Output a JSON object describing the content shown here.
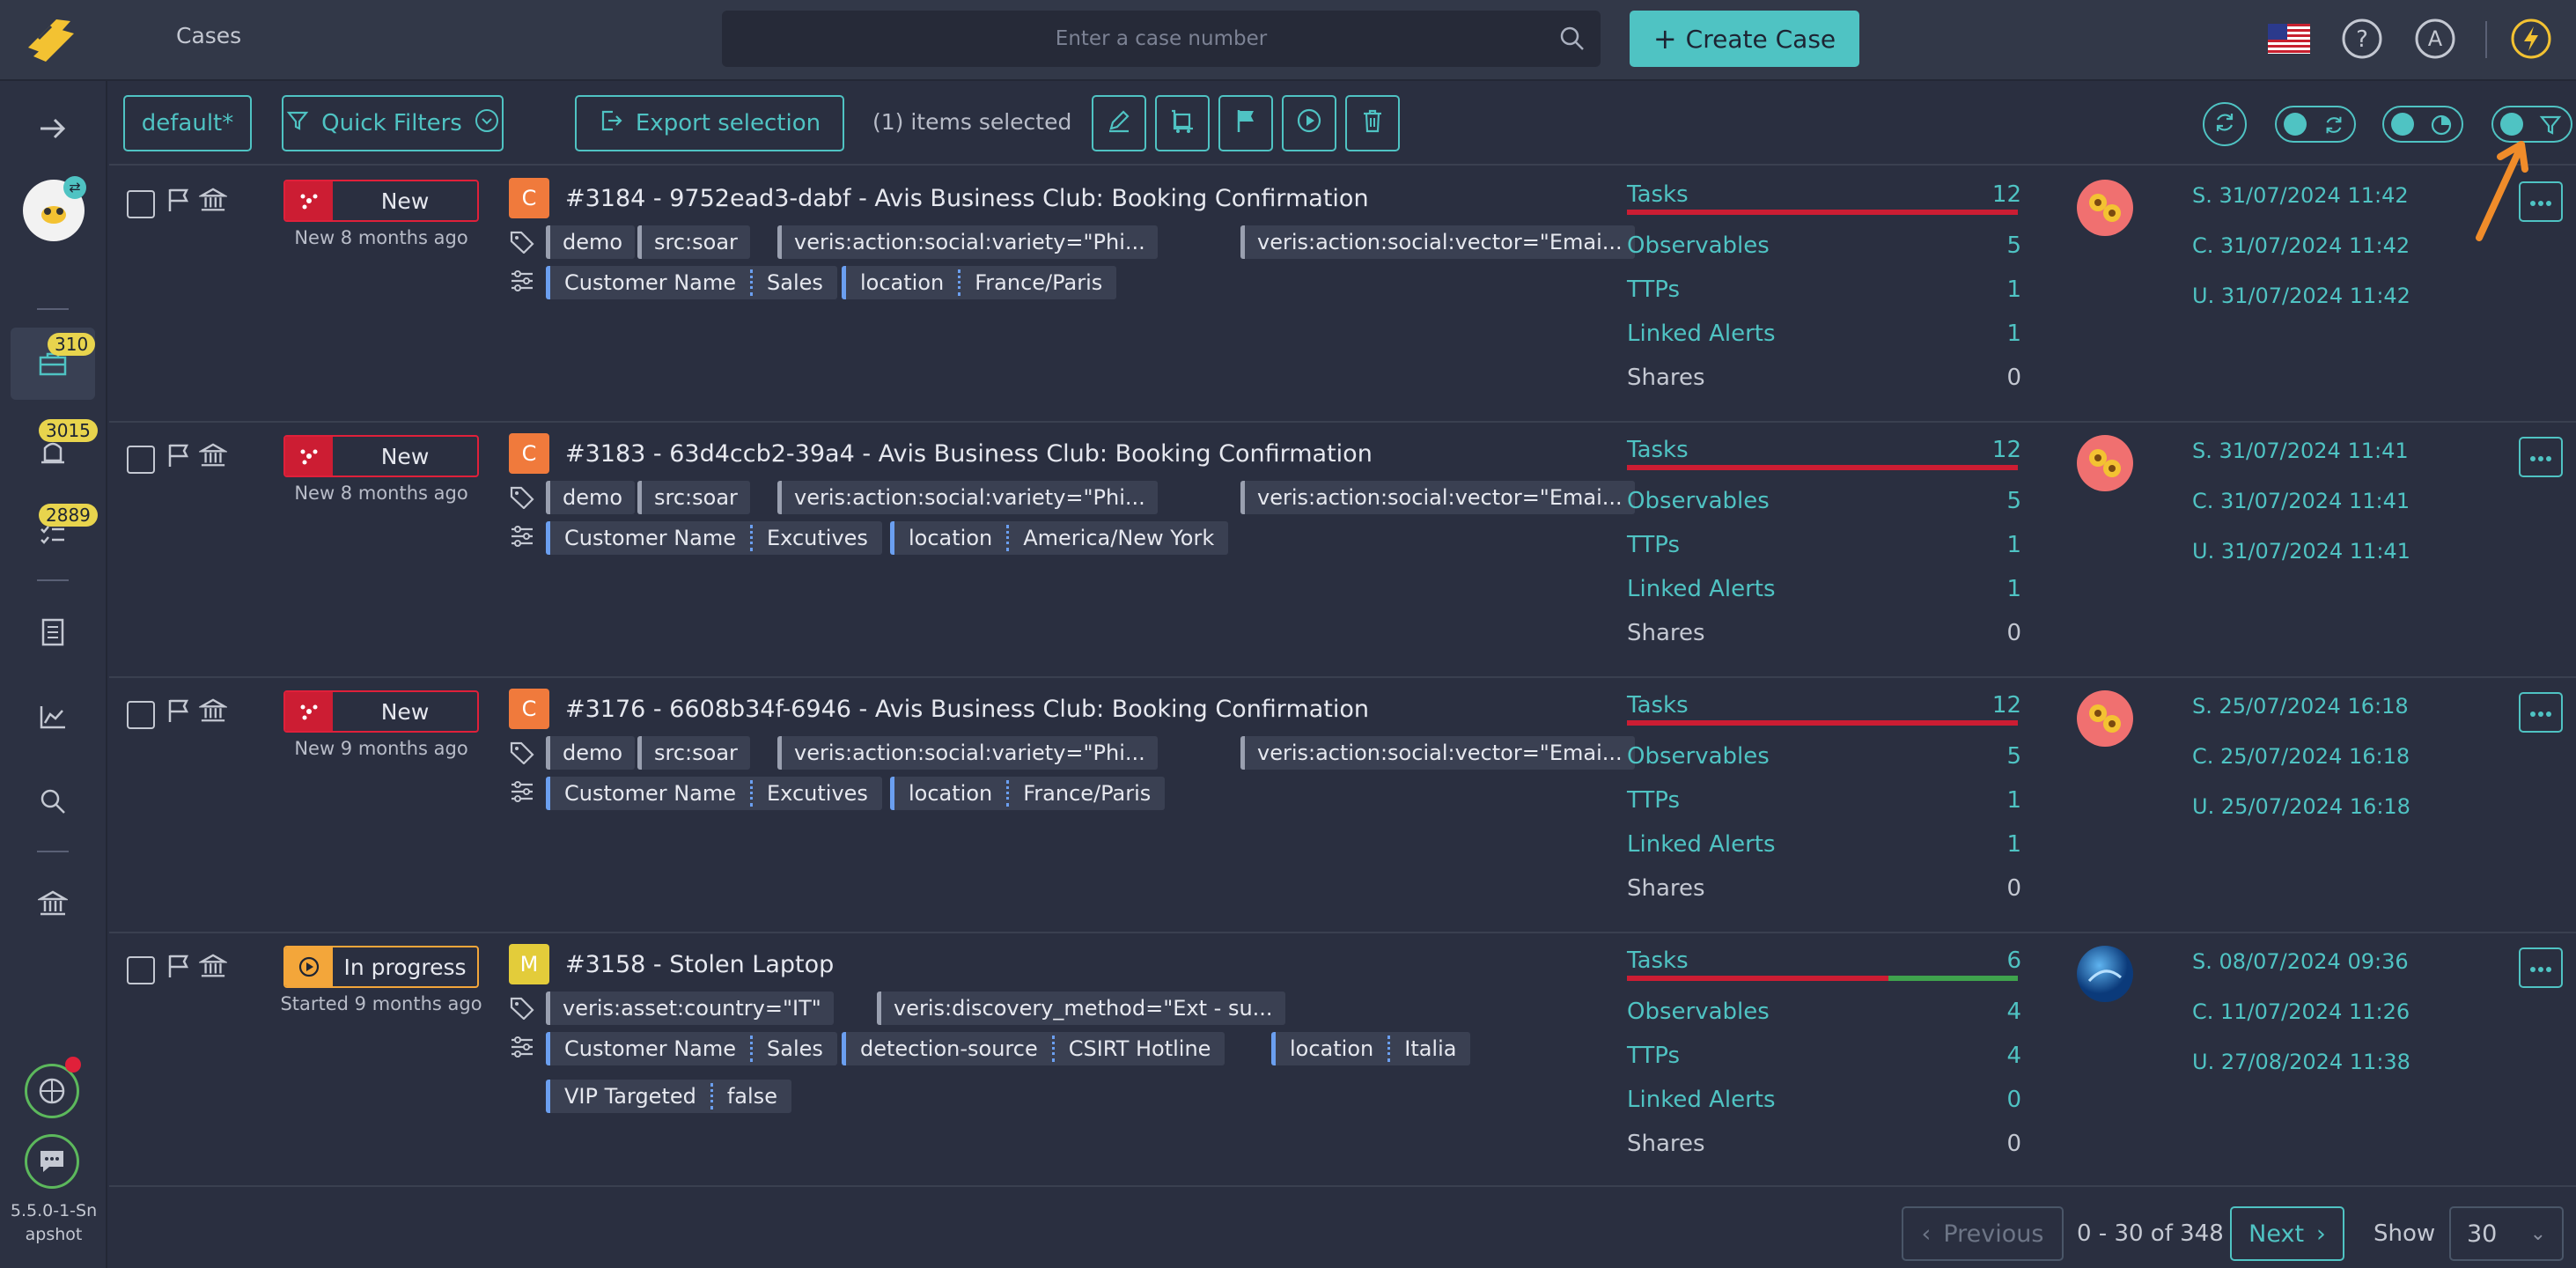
{
  "header": {
    "title": "Cases",
    "search_placeholder": "Enter a case number",
    "create_label": "Create Case",
    "user_initial": "A"
  },
  "sidebar": {
    "badges": {
      "cases": "310",
      "alerts": "3015",
      "tasks": "2889"
    },
    "version": "5.5.0-1-Snapshot"
  },
  "toolbar": {
    "view": "default*",
    "quick_filters": "Quick Filters",
    "export": "Export selection",
    "selected": "(1) items selected"
  },
  "stat_labels": {
    "tasks": "Tasks",
    "observables": "Observables",
    "ttps": "TTPs",
    "linked_alerts": "Linked Alerts",
    "shares": "Shares"
  },
  "cases": [
    {
      "status": "New",
      "status_sub": "New 8 months ago",
      "severity": "C",
      "severity_color": "#f07a3c",
      "title": "#3184 - 9752ead3-dabf - Avis Business Club: Booking Confirmation",
      "tags": [
        "demo",
        "src:soar",
        "veris:action:social:variety=\"Phi...",
        "veris:action:social:vector=\"Emai..."
      ],
      "fields": [
        [
          "Customer Name",
          "Sales"
        ],
        [
          "location",
          "France/Paris"
        ]
      ],
      "stats": {
        "tasks": "12",
        "observables": "5",
        "ttps": "1",
        "linked_alerts": "1",
        "shares": "0"
      },
      "task_progress": 0,
      "dates": [
        "S. 31/07/2024 11:42",
        "C. 31/07/2024 11:42",
        "U. 31/07/2024 11:42"
      ]
    },
    {
      "status": "New",
      "status_sub": "New 8 months ago",
      "severity": "C",
      "severity_color": "#f07a3c",
      "title": "#3183 - 63d4ccb2-39a4 - Avis Business Club: Booking Confirmation",
      "tags": [
        "demo",
        "src:soar",
        "veris:action:social:variety=\"Phi...",
        "veris:action:social:vector=\"Emai..."
      ],
      "fields": [
        [
          "Customer Name",
          "Excutives"
        ],
        [
          "location",
          "America/New York"
        ]
      ],
      "stats": {
        "tasks": "12",
        "observables": "5",
        "ttps": "1",
        "linked_alerts": "1",
        "shares": "0"
      },
      "task_progress": 0,
      "dates": [
        "S. 31/07/2024 11:41",
        "C. 31/07/2024 11:41",
        "U. 31/07/2024 11:41"
      ]
    },
    {
      "status": "New",
      "status_sub": "New 9 months ago",
      "severity": "C",
      "severity_color": "#f07a3c",
      "title": "#3176 - 6608b34f-6946 - Avis Business Club: Booking Confirmation",
      "tags": [
        "demo",
        "src:soar",
        "veris:action:social:variety=\"Phi...",
        "veris:action:social:vector=\"Emai..."
      ],
      "fields": [
        [
          "Customer Name",
          "Excutives"
        ],
        [
          "location",
          "France/Paris"
        ]
      ],
      "stats": {
        "tasks": "12",
        "observables": "5",
        "ttps": "1",
        "linked_alerts": "1",
        "shares": "0"
      },
      "task_progress": 0,
      "dates": [
        "S. 25/07/2024 16:18",
        "C. 25/07/2024 16:18",
        "U. 25/07/2024 16:18"
      ]
    },
    {
      "status": "In progress",
      "status_sub": "Started 9 months ago",
      "severity": "M",
      "severity_color": "#e3cc3a",
      "title": "#3158 - Stolen Laptop",
      "tags": [
        "veris:asset:country=\"IT\"",
        "veris:discovery_method=\"Ext - su..."
      ],
      "fields": [
        [
          "Customer Name",
          "Sales"
        ],
        [
          "detection-source",
          "CSIRT Hotline"
        ],
        [
          "location",
          "Italia"
        ],
        [
          "VIP Targeted",
          "false"
        ]
      ],
      "stats": {
        "tasks": "6",
        "observables": "4",
        "ttps": "4",
        "linked_alerts": "0",
        "shares": "0"
      },
      "task_progress": 0.33,
      "dates": [
        "S. 08/07/2024 09:36",
        "C. 11/07/2024 11:26",
        "U. 27/08/2024 11:38"
      ]
    }
  ],
  "pagination": {
    "previous": "Previous",
    "range": "0 - 30 of 348",
    "next": "Next",
    "show_label": "Show",
    "page_size": "30"
  }
}
